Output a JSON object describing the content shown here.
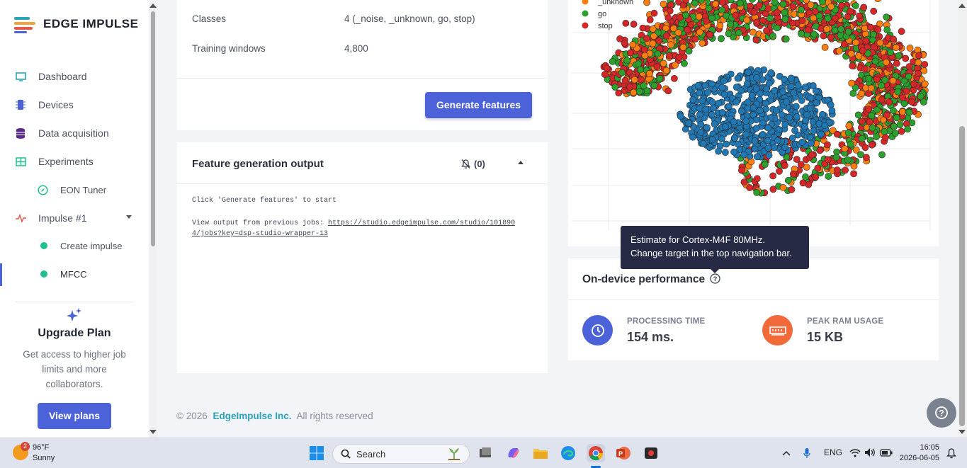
{
  "sidebar": {
    "logo_text": "EDGE IMPULSE",
    "items": [
      {
        "label": "Dashboard"
      },
      {
        "label": "Devices"
      },
      {
        "label": "Data acquisition"
      },
      {
        "label": "Experiments"
      },
      {
        "label": "EON Tuner"
      },
      {
        "label": "Impulse #1"
      },
      {
        "label": "Create impulse"
      },
      {
        "label": "MFCC"
      }
    ],
    "upgrade": {
      "title": "Upgrade Plan",
      "text": "Get access to higher job limits and more collaborators.",
      "button": "View plans"
    }
  },
  "training": {
    "classes_label": "Classes",
    "classes_value": "4 (_noise, _unknown, go, stop)",
    "windows_label": "Training windows",
    "windows_value": "4,800",
    "generate_button": "Generate features"
  },
  "output": {
    "title": "Feature generation output",
    "notification_count": "(0)",
    "line1": "Click 'Generate features' to start",
    "line2_prefix": "View output from previous jobs: ",
    "line2_link_a": "https://studio.edgeimpulse.com/studio/101890",
    "line2_link_b": "4/jobs?key=dsp-studio-wrapper-13"
  },
  "chart_data": {
    "type": "scatter",
    "legend": [
      "_unknown",
      "go",
      "stop"
    ],
    "legend_colors": [
      "#ff7f0e",
      "#2ca02c",
      "#d62728"
    ],
    "series": [
      {
        "name": "_noise",
        "color": "#1f77b4"
      },
      {
        "name": "_unknown",
        "color": "#ff7f0e"
      },
      {
        "name": "go",
        "color": "#2ca02c"
      },
      {
        "name": "stop",
        "color": "#d62728"
      }
    ],
    "grid": true
  },
  "tooltip": "Estimate for Cortex-M4F 80MHz. Change target in the top navigation bar.",
  "performance": {
    "title": "On-device performance",
    "processing_label": "PROCESSING TIME",
    "processing_value": "154 ms.",
    "ram_label": "PEAK RAM USAGE",
    "ram_value": "15 KB"
  },
  "footer": {
    "copyright": "© 2026",
    "company": "EdgeImpulse Inc.",
    "rights": "All rights reserved"
  },
  "taskbar": {
    "weather_badge": "2",
    "temperature": "96°F",
    "condition": "Sunny",
    "search_label": "Search",
    "language": "ENG",
    "time": "16:05",
    "date": "2026-06-05"
  }
}
